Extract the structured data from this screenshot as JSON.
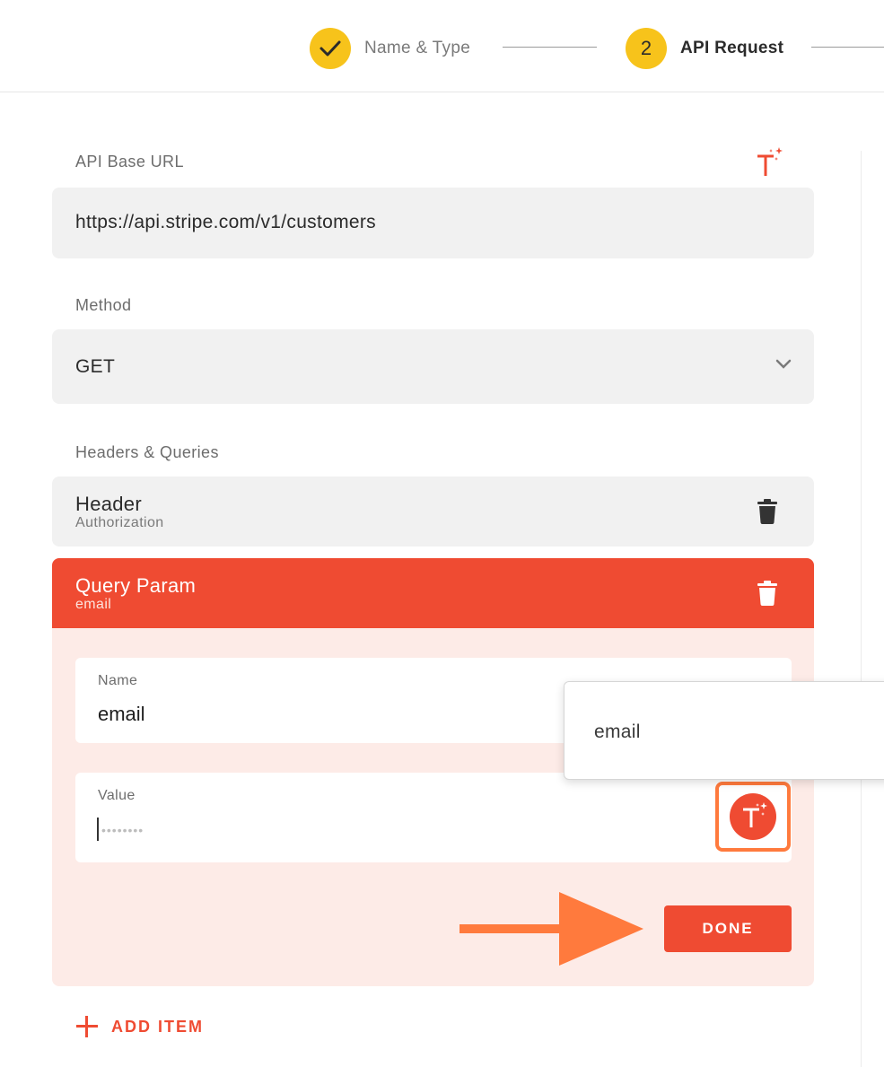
{
  "stepper": {
    "steps": [
      {
        "label": "Name & Type",
        "state": "complete"
      },
      {
        "label": "API Request",
        "number": "2",
        "state": "active"
      }
    ]
  },
  "form": {
    "base_url": {
      "label": "API Base URL",
      "value": "https://api.stripe.com/v1/customers"
    },
    "method": {
      "label": "Method",
      "value": "GET"
    },
    "headers_queries_label": "Headers & Queries"
  },
  "items": [
    {
      "title": "Header",
      "subtitle": "Authorization"
    },
    {
      "title": "Query Param",
      "subtitle": "email"
    }
  ],
  "query_param_editor": {
    "name_label": "Name",
    "name_value": "email",
    "value_label": "Value",
    "value_masked": "••••••••",
    "done_label": "DONE"
  },
  "suggestion_popup": {
    "option": "email"
  },
  "add_item_label": "ADD ITEM",
  "colors": {
    "accent": "#ef4b32",
    "step_yellow": "#f7c31b",
    "highlight_orange": "#ff7a3d",
    "panel_tint": "#fdebe7",
    "field_bg": "#f1f1f1"
  },
  "icons": [
    "check-icon",
    "chevron-down-icon",
    "trash-icon",
    "t-sparkle-icon",
    "plus-icon",
    "arrow-right-icon"
  ]
}
